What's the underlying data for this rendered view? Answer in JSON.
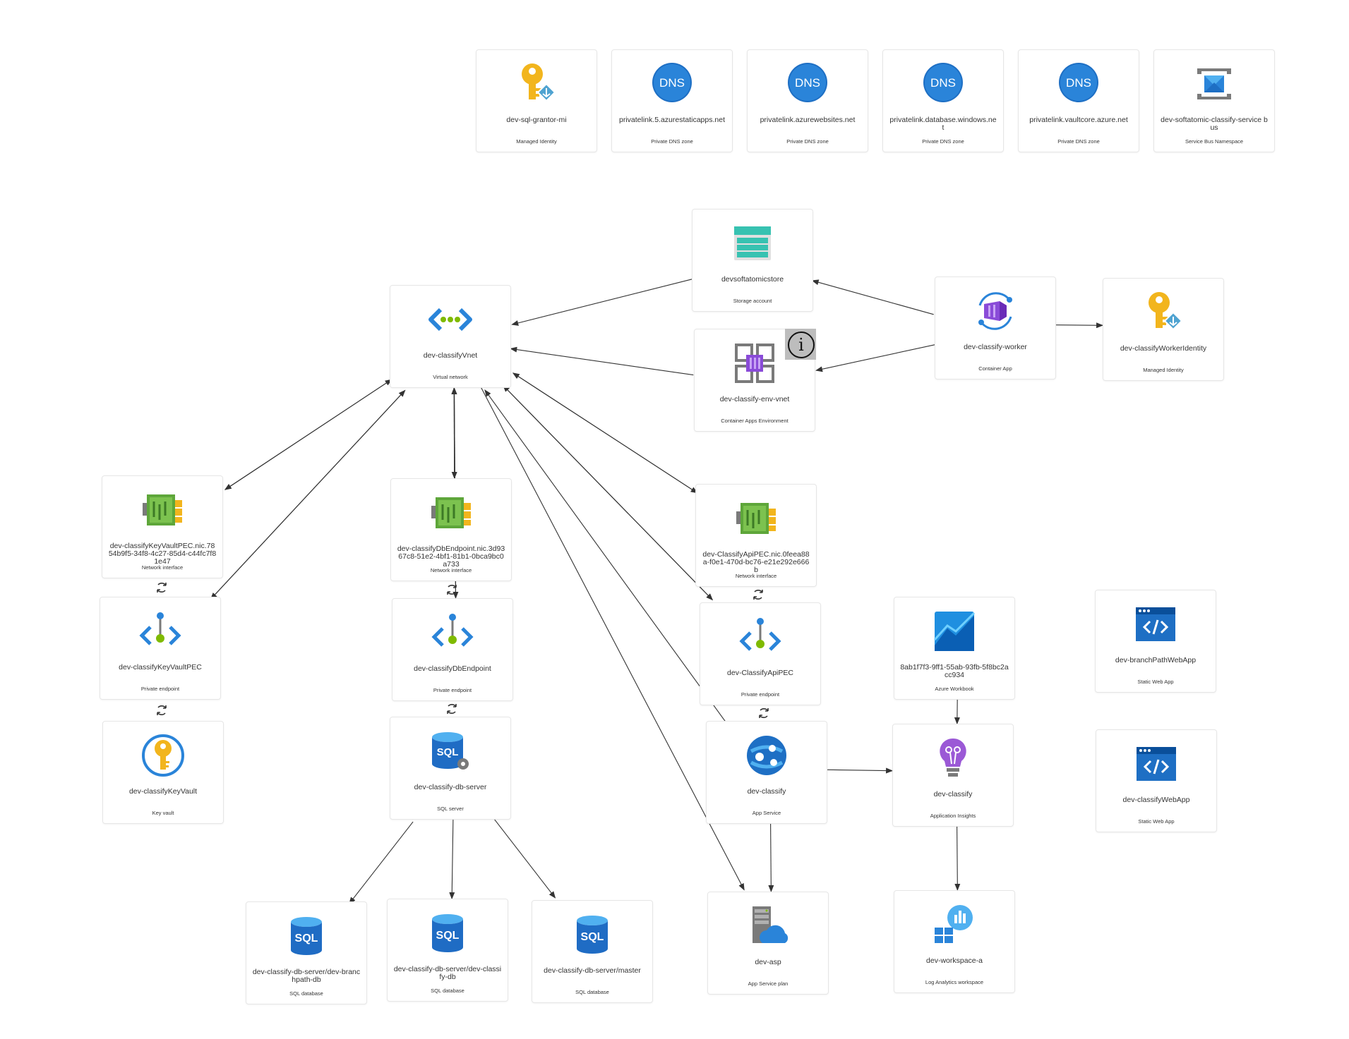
{
  "nodes": [
    {
      "id": "sqlgrantor",
      "name": "dev-sql-grantor-mi",
      "type": "Managed Identity",
      "icon": "managed-identity-icon"
    },
    {
      "id": "dns_static",
      "name": "privatelink.5.azurestaticapps.net",
      "type": "Private DNS zone",
      "icon": "dns-icon"
    },
    {
      "id": "dns_web",
      "name": "privatelink.azurewebsites.net",
      "type": "Private DNS zone",
      "icon": "dns-icon"
    },
    {
      "id": "dns_db",
      "name": "privatelink.database.windows.net",
      "type": "Private DNS zone",
      "icon": "dns-icon"
    },
    {
      "id": "dns_vault",
      "name": "privatelink.vaultcore.azure.net",
      "type": "Private DNS zone",
      "icon": "dns-icon"
    },
    {
      "id": "servicebus",
      "name": "dev-softatomic-classify-service bus",
      "type": "Service Bus Namespace",
      "icon": "service-bus-icon"
    },
    {
      "id": "storage",
      "name": "devsoftatomicstore",
      "type": "Storage account",
      "icon": "storage-account-icon"
    },
    {
      "id": "vnet",
      "name": "dev-classifyVnet",
      "type": "Virtual network",
      "icon": "virtual-network-icon"
    },
    {
      "id": "envvnet",
      "name": "dev-classify-env-vnet",
      "type": "Container Apps Environment",
      "icon": "container-apps-environment-icon"
    },
    {
      "id": "worker",
      "name": "dev-classify-worker",
      "type": "Container App",
      "icon": "container-app-icon"
    },
    {
      "id": "workerid",
      "name": "dev-classifyWorkerIdentity",
      "type": "Managed Identity",
      "icon": "managed-identity-icon"
    },
    {
      "id": "nic_kv",
      "name": "dev-classifyKeyVaultPEC.nic.7854b9f5-34f8-4c27-85d4-c44fc7f81e47",
      "type": "Network interface",
      "icon": "network-interface-icon"
    },
    {
      "id": "nic_db",
      "name": "dev-classifyDbEndpoint.nic.3d9367c8-51e2-4bf1-81b1-0bca9bc0a733",
      "type": "Network interface",
      "icon": "network-interface-icon"
    },
    {
      "id": "nic_api",
      "name": "dev-ClassifyApiPEC.nic.0feea88a-f0e1-470d-bc76-e21e292e666b",
      "type": "Network interface",
      "icon": "network-interface-icon"
    },
    {
      "id": "pe_kv",
      "name": "dev-classifyKeyVaultPEC",
      "type": "Private endpoint",
      "icon": "private-endpoint-icon"
    },
    {
      "id": "pe_db",
      "name": "dev-classifyDbEndpoint",
      "type": "Private endpoint",
      "icon": "private-endpoint-icon"
    },
    {
      "id": "pe_api",
      "name": "dev-ClassifyApiPEC",
      "type": "Private endpoint",
      "icon": "private-endpoint-icon"
    },
    {
      "id": "workbook",
      "name": "8ab1f7f3-9ff1-55ab-93fb-5f8bc2acc934",
      "type": "Azure Workbook",
      "icon": "workbook-icon"
    },
    {
      "id": "swa_branch",
      "name": "dev-branchPathWebApp",
      "type": "Static Web App",
      "icon": "static-web-app-icon"
    },
    {
      "id": "keyvault",
      "name": "dev-classifyKeyVault",
      "type": "Key vault",
      "icon": "key-vault-icon"
    },
    {
      "id": "dbserver",
      "name": "dev-classify-db-server",
      "type": "SQL server",
      "icon": "sql-server-icon"
    },
    {
      "id": "appsvc",
      "name": "dev-classify",
      "type": "App Service",
      "icon": "app-service-icon"
    },
    {
      "id": "appins",
      "name": "dev-classify",
      "type": "Application Insights",
      "icon": "application-insights-icon"
    },
    {
      "id": "swa_web",
      "name": "dev-classifyWebApp",
      "type": "Static Web App",
      "icon": "static-web-app-icon"
    },
    {
      "id": "db_branch",
      "name": "dev-classify-db-server/dev-branchpath-db",
      "type": "SQL database",
      "icon": "sql-database-icon"
    },
    {
      "id": "db_classify",
      "name": "dev-classify-db-server/dev-classify-db",
      "type": "SQL database",
      "icon": "sql-database-icon"
    },
    {
      "id": "db_master",
      "name": "dev-classify-db-server/master",
      "type": "SQL database",
      "icon": "sql-database-icon"
    },
    {
      "id": "asp",
      "name": "dev-asp",
      "type": "App Service plan",
      "icon": "app-service-plan-icon"
    },
    {
      "id": "workspace",
      "name": "dev-workspace-a",
      "type": "Log Analytics workspace",
      "icon": "log-analytics-icon"
    }
  ],
  "edges": [
    {
      "from": "storage",
      "to": "vnet"
    },
    {
      "from": "worker",
      "to": "storage"
    },
    {
      "from": "envvnet",
      "to": "vnet"
    },
    {
      "from": "worker",
      "to": "envvnet"
    },
    {
      "from": "worker",
      "to": "workerid"
    },
    {
      "from": "vnet",
      "to": "nic_kv"
    },
    {
      "from": "nic_kv",
      "to": "vnet"
    },
    {
      "from": "vnet",
      "to": "pe_kv"
    },
    {
      "from": "pe_kv",
      "to": "vnet"
    },
    {
      "from": "vnet",
      "to": "nic_db"
    },
    {
      "from": "nic_db",
      "to": "vnet"
    },
    {
      "from": "vnet",
      "to": "pe_db"
    },
    {
      "from": "pe_db",
      "to": "vnet"
    },
    {
      "from": "vnet",
      "to": "nic_api"
    },
    {
      "from": "nic_api",
      "to": "vnet"
    },
    {
      "from": "vnet",
      "to": "pe_api"
    },
    {
      "from": "pe_api",
      "to": "vnet"
    },
    {
      "from": "appsvc",
      "to": "vnet"
    },
    {
      "from": "vnet",
      "to": "asp"
    },
    {
      "from": "dbserver",
      "to": "db_branch"
    },
    {
      "from": "dbserver",
      "to": "db_classify"
    },
    {
      "from": "dbserver",
      "to": "db_master"
    },
    {
      "from": "appsvc",
      "to": "asp"
    },
    {
      "from": "appsvc",
      "to": "appins"
    },
    {
      "from": "workbook",
      "to": "appins"
    },
    {
      "from": "appins",
      "to": "workspace"
    }
  ],
  "cycles": [
    {
      "between": [
        "nic_kv",
        "pe_kv"
      ]
    },
    {
      "between": [
        "pe_kv",
        "keyvault"
      ]
    },
    {
      "between": [
        "nic_db",
        "pe_db"
      ]
    },
    {
      "between": [
        "pe_db",
        "dbserver"
      ]
    },
    {
      "between": [
        "nic_api",
        "pe_api"
      ]
    },
    {
      "between": [
        "pe_api",
        "appsvc"
      ]
    }
  ],
  "info_badge": {
    "symbol": "i",
    "on": "envvnet"
  },
  "colors": {
    "edge": "#333333",
    "node_border": "#e6e6e6",
    "label": "#333333",
    "azure_blue": "#0078d4",
    "key_yellow": "#f2b51d",
    "nic_green": "#5ea63a",
    "container_purple": "#8a4bd8",
    "sql_blue": "#1f6cc4"
  }
}
